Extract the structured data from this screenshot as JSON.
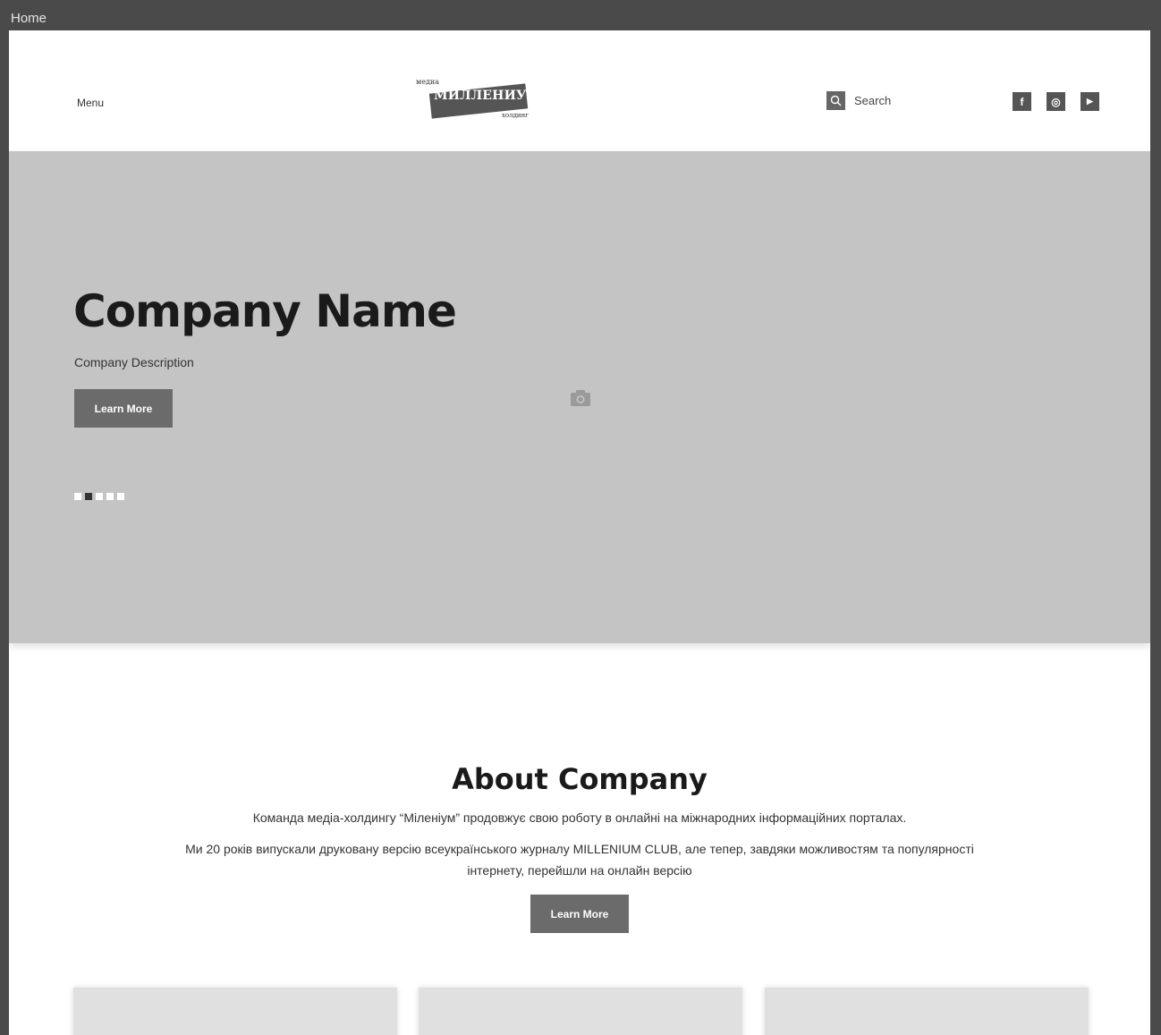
{
  "frame": {
    "label": "Home"
  },
  "header": {
    "menu_label": "Menu",
    "logo": {
      "top": "медиа",
      "main": "МИЛЛЕНИУМ",
      "sub": "холдинг"
    },
    "search_label": "Search",
    "socials": [
      {
        "name": "facebook-icon",
        "glyph": "f"
      },
      {
        "name": "instagram-icon",
        "glyph": "◎"
      },
      {
        "name": "youtube-icon",
        "glyph": "▶"
      }
    ]
  },
  "hero": {
    "title": "Company Name",
    "description": "Company Description",
    "button": "Learn More",
    "slides": 5,
    "active_slide": 2
  },
  "about": {
    "title": "About Company",
    "p1": "Команда медіа-холдингу “Міленіум” продовжує свою роботу в онлайні на міжнародних інформаційних порталах.",
    "p2": "Ми 20 років випускали друковану версію всеукраїнського журналу MILLENIUM CLUB, але тепер, завдяки можливостям та популярності інтернету, перейшли на онлайн версію",
    "button": "Learn More"
  },
  "cards": [
    {
      "id": 1
    },
    {
      "id": 2
    },
    {
      "id": 3
    }
  ]
}
